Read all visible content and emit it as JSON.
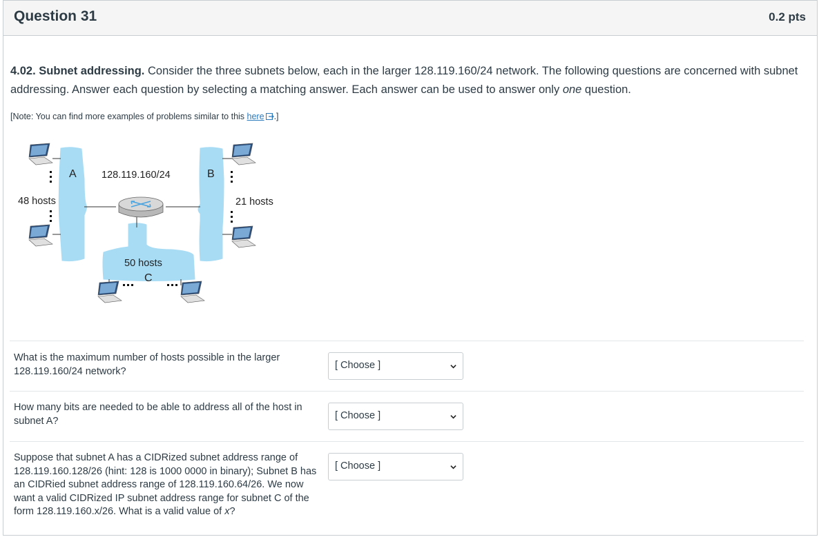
{
  "question": {
    "title": "Question 31",
    "points": "0.2 pts"
  },
  "intro": {
    "heading": "4.02. Subnet addressing.",
    "text_1": " Consider the three subnets below, each in the larger 128.119.160/24 network.  The following questions are concerned with subnet addressing.  Answer each question by selecting a matching answer.  Each answer can be used to answer only ",
    "emphasis": "one",
    "text_2": " question."
  },
  "note": {
    "prefix": "[Note: You can find more examples of problems similar to this ",
    "link_text": "here",
    "suffix": ".]"
  },
  "diagram": {
    "label_a": "A",
    "label_b": "B",
    "label_c": "C",
    "network": "128.119.160/24",
    "hosts_a": "48 hosts",
    "hosts_b": "21 hosts",
    "hosts_c": "50 hosts",
    "subnet_color": "#a8dcf5"
  },
  "answers": [
    {
      "question": "What is the maximum number of hosts possible in the larger 128.119.160/24 network?",
      "selected": "[ Choose ]"
    },
    {
      "question": "How many bits are needed to be able to address all of the host in subnet A?",
      "selected": "[ Choose ]"
    },
    {
      "question_1": "Suppose that subnet A has a CIDRized subnet address range of 128.119.160.128/26 (hint: 128 is 1000 0000 in binary); Subnet B has an CIDRied subnet address range of 128.119.160.64/26.  We now want a valid CIDRized IP subnet address range for subnet C of the form 128.119.160.x/26.  What is a valid value of ",
      "question_var": "x",
      "question_2": "?",
      "selected": "[ Choose ]"
    }
  ]
}
